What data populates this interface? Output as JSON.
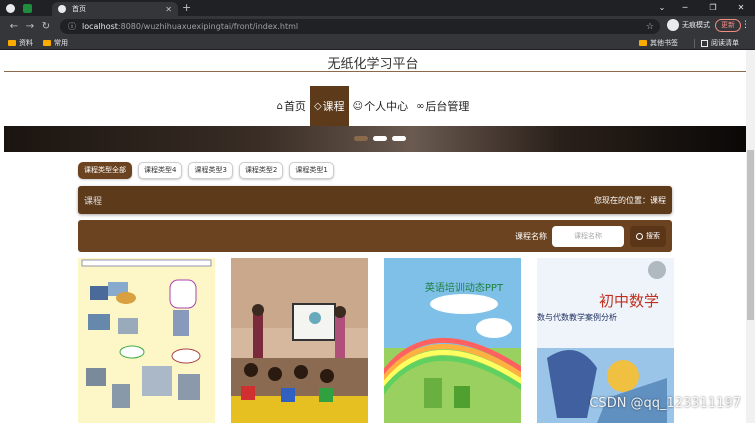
{
  "browser": {
    "tab_title": "首页",
    "url_host": "localhost",
    "url_path": ":8080/wuzhihuaxuexipingtai/front/index.html",
    "incognito_label": "无痕模式",
    "update_label": "更新",
    "bookmarks": [
      "资料",
      "常用"
    ],
    "bookmarks_right": [
      "其他书签",
      "阅读清单"
    ]
  },
  "site": {
    "title": "无纸化学习平台"
  },
  "nav": [
    {
      "label": "首页",
      "icon": "home-icon",
      "active": false
    },
    {
      "label": "课程",
      "icon": "tag-icon",
      "active": true
    },
    {
      "label": "个人中心",
      "icon": "user-icon",
      "active": false
    },
    {
      "label": "后台管理",
      "icon": "link-icon",
      "active": false
    }
  ],
  "categories": [
    "课程类型全部",
    "课程类型4",
    "课程类型3",
    "课程类型2",
    "课程类型1"
  ],
  "breadcrumb": {
    "section": "课程",
    "location": "您现在的位置：课程"
  },
  "search": {
    "label": "课程名称",
    "placeholder": "课程名称",
    "button": "搜索"
  },
  "card_images": {
    "card3_text": "英语培训动态PPT",
    "card4_text": "初中数学",
    "card4_sub": "数与代数教学案例分析"
  },
  "watermark": "CSDN @qq_123311197"
}
